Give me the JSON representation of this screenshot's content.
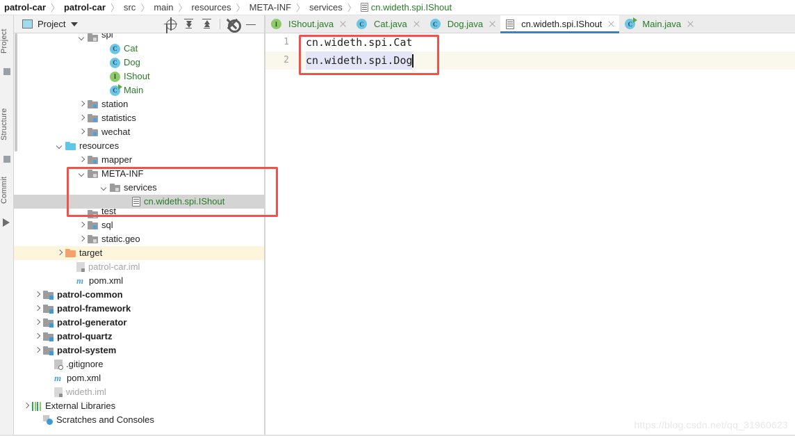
{
  "breadcrumb": {
    "items": [
      {
        "label": "patrol-car",
        "style": "bold"
      },
      {
        "label": "patrol-car",
        "style": "bold"
      },
      {
        "label": "src",
        "style": "normal"
      },
      {
        "label": "main",
        "style": "normal"
      },
      {
        "label": "resources",
        "style": "normal"
      },
      {
        "label": "META-INF",
        "style": "normal"
      },
      {
        "label": "services",
        "style": "normal"
      },
      {
        "label": "cn.wideth.spi.IShout",
        "style": "green",
        "icon": "text-file-icon"
      }
    ],
    "separator": "〉"
  },
  "toolstrip": {
    "labels": [
      "Project",
      "Structure",
      "Commit"
    ]
  },
  "project_panel": {
    "title": "Project",
    "caret": "chevron-down-icon",
    "tools": [
      {
        "name": "locate-icon"
      },
      {
        "name": "expand-all-icon"
      },
      {
        "name": "collapse-all-icon"
      },
      {
        "name": "settings-gear-icon"
      },
      {
        "name": "minimize-icon"
      }
    ],
    "tree": [
      {
        "label": "spi",
        "indent": 5,
        "twisty": "down",
        "icon": "folder-gray",
        "clipped": true
      },
      {
        "label": "Cat",
        "indent": 7,
        "twisty": "none",
        "icon": "class-icon",
        "color": "green"
      },
      {
        "label": "Dog",
        "indent": 7,
        "twisty": "none",
        "icon": "class-icon",
        "color": "green"
      },
      {
        "label": "IShout",
        "indent": 7,
        "twisty": "none",
        "icon": "interface-icon",
        "color": "green"
      },
      {
        "label": "Main",
        "indent": 7,
        "twisty": "none",
        "icon": "class-run-icon",
        "color": "green"
      },
      {
        "label": "station",
        "indent": 5,
        "twisty": "right",
        "icon": "folder-src"
      },
      {
        "label": "statistics",
        "indent": 5,
        "twisty": "right",
        "icon": "folder-src"
      },
      {
        "label": "wechat",
        "indent": 5,
        "twisty": "right",
        "icon": "folder-src"
      },
      {
        "label": "resources",
        "indent": 3,
        "twisty": "down",
        "icon": "folder-blue"
      },
      {
        "label": "mapper",
        "indent": 5,
        "twisty": "right",
        "icon": "folder-src"
      },
      {
        "label": "META-INF",
        "indent": 5,
        "twisty": "down",
        "icon": "folder-gray"
      },
      {
        "label": "services",
        "indent": 7,
        "twisty": "down",
        "icon": "folder-gray"
      },
      {
        "label": "cn.wideth.spi.IShout",
        "indent": 9,
        "twisty": "none",
        "icon": "text-file-icon",
        "color": "green",
        "selected": true
      },
      {
        "label": "test",
        "indent": 5,
        "twisty": "none",
        "icon": "folder-gray",
        "clipped": true
      },
      {
        "label": "sql",
        "indent": 5,
        "twisty": "right",
        "icon": "folder-src"
      },
      {
        "label": "static.geo",
        "indent": 5,
        "twisty": "right",
        "icon": "folder-gray"
      },
      {
        "label": "target",
        "indent": 3,
        "twisty": "right",
        "icon": "folder-orange",
        "highlight": "yellow"
      },
      {
        "label": "patrol-car.iml",
        "indent": 4,
        "twisty": "none",
        "icon": "iml-faded-icon",
        "color": "gray"
      },
      {
        "label": "pom.xml",
        "indent": 4,
        "twisty": "none",
        "icon": "maven-icon"
      },
      {
        "label": "patrol-common",
        "indent": 1,
        "twisty": "right",
        "icon": "module-icon",
        "bold": true
      },
      {
        "label": "patrol-framework",
        "indent": 1,
        "twisty": "right",
        "icon": "module-icon",
        "bold": true
      },
      {
        "label": "patrol-generator",
        "indent": 1,
        "twisty": "right",
        "icon": "module-icon",
        "bold": true
      },
      {
        "label": "patrol-quartz",
        "indent": 1,
        "twisty": "right",
        "icon": "module-icon",
        "bold": true
      },
      {
        "label": "patrol-system",
        "indent": 1,
        "twisty": "right",
        "icon": "module-icon",
        "bold": true
      },
      {
        "label": ".gitignore",
        "indent": 2,
        "twisty": "none",
        "icon": "gitignore-icon"
      },
      {
        "label": "pom.xml",
        "indent": 2,
        "twisty": "none",
        "icon": "maven-icon"
      },
      {
        "label": "wideth.iml",
        "indent": 2,
        "twisty": "none",
        "icon": "iml-faded-icon",
        "color": "gray"
      },
      {
        "label": "External Libraries",
        "indent": 0,
        "twisty": "right",
        "icon": "libraries-icon"
      },
      {
        "label": "Scratches and Consoles",
        "indent": 1,
        "twisty": "none",
        "icon": "scratches-icon"
      }
    ]
  },
  "editor_tabs": [
    {
      "label": "IShout.java",
      "icon": "interface-icon",
      "active": false
    },
    {
      "label": "Cat.java",
      "icon": "class-icon",
      "active": false
    },
    {
      "label": "Dog.java",
      "icon": "class-icon",
      "active": false
    },
    {
      "label": "cn.wideth.spi.IShout",
      "icon": "text-file-icon",
      "active": true
    },
    {
      "label": "Main.java",
      "icon": "class-run-icon",
      "active": false
    }
  ],
  "editor": {
    "lines": [
      {
        "number": "1",
        "text": "cn.wideth.spi.Cat",
        "current": false,
        "selected": false
      },
      {
        "number": "2",
        "text": "cn.wideth.spi.Dog",
        "current": true,
        "selected": true
      }
    ]
  },
  "annotations": [
    {
      "name": "editor-redbox"
    },
    {
      "name": "tree-redbox"
    }
  ],
  "watermark": "https://blog.csdn.net/qq_31960623",
  "colors": {
    "accent_blue": "#3d7fc1",
    "annotation_red": "#f0514a",
    "green_text": "#277b27",
    "current_line": "#faf8ec",
    "selection": "#e4e5f6",
    "tree_selection": "#d4d4d4",
    "yellow_row": "#fdf6dd"
  }
}
